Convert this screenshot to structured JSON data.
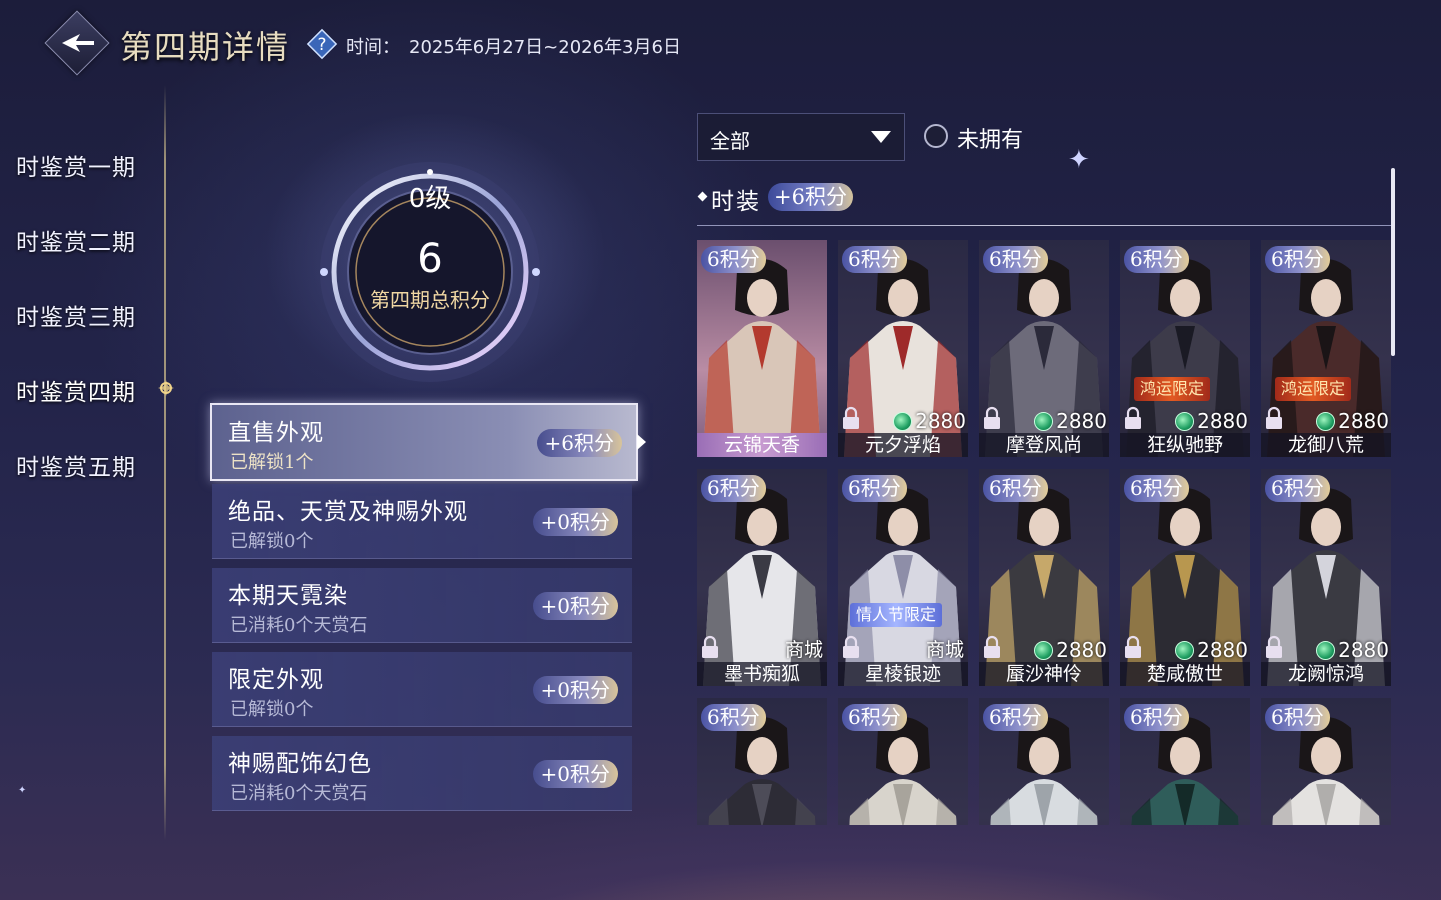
{
  "header": {
    "title": "第四期详情",
    "time_label": "时间：",
    "time_value": "2025年6月27日~2026年3月6日"
  },
  "nav": {
    "items": [
      {
        "label": "时鉴赏一期",
        "active": false
      },
      {
        "label": "时鉴赏二期",
        "active": false
      },
      {
        "label": "时鉴赏三期",
        "active": false
      },
      {
        "label": "时鉴赏四期",
        "active": true
      },
      {
        "label": "时鉴赏五期",
        "active": false
      }
    ]
  },
  "score": {
    "level": "0级",
    "total": "6",
    "label": "第四期总积分"
  },
  "categories": [
    {
      "title": "直售外观",
      "sub": "已解锁1个",
      "points": "+6积分",
      "active": true
    },
    {
      "title": "绝品、天赏及神赐外观",
      "sub": "已解锁0个",
      "points": "+0积分",
      "active": false
    },
    {
      "title": "本期天霓染",
      "sub": "已消耗0个天赏石",
      "points": "+0积分",
      "active": false
    },
    {
      "title": "限定外观",
      "sub": "已解锁0个",
      "points": "+0积分",
      "active": false
    },
    {
      "title": "神赐配饰幻色",
      "sub": "已消耗0个天赏石",
      "points": "+0积分",
      "active": false
    }
  ],
  "filter": {
    "dropdown_value": "全部",
    "unowned_label": "未拥有"
  },
  "section": {
    "title": "时装",
    "points": "+6积分"
  },
  "items": [
    {
      "badge": "6积分",
      "name": "云锦天香",
      "selected": true
    },
    {
      "badge": "6积分",
      "name": "元夕浮焰",
      "price": "2880"
    },
    {
      "badge": "6积分",
      "name": "摩登风尚",
      "price": "2880"
    },
    {
      "badge": "6积分",
      "name": "狂纵驰野",
      "price": "2880",
      "tag": "鸿运限定"
    },
    {
      "badge": "6积分",
      "name": "龙御八荒",
      "price": "2880",
      "tag": "鸿运限定"
    },
    {
      "badge": "6积分",
      "name": "墨书痴狐",
      "shop": "商城"
    },
    {
      "badge": "6积分",
      "name": "星棱银迹",
      "shop": "商城",
      "tag_blue": "情人节限定"
    },
    {
      "badge": "6积分",
      "name": "蜃沙神伶",
      "price": "2880"
    },
    {
      "badge": "6积分",
      "name": "楚咸傲世",
      "price": "2880"
    },
    {
      "badge": "6积分",
      "name": "龙阙惊鸿",
      "price": "2880"
    },
    {
      "badge": "6积分"
    },
    {
      "badge": "6积分"
    },
    {
      "badge": "6积分"
    },
    {
      "badge": "6积分"
    },
    {
      "badge": "6积分"
    }
  ],
  "colors": {
    "bg": "#23244a",
    "accent_gold": "#e7dcc0",
    "pill_gradient_end": "#d8c49a",
    "coin": "#1f9f62"
  }
}
